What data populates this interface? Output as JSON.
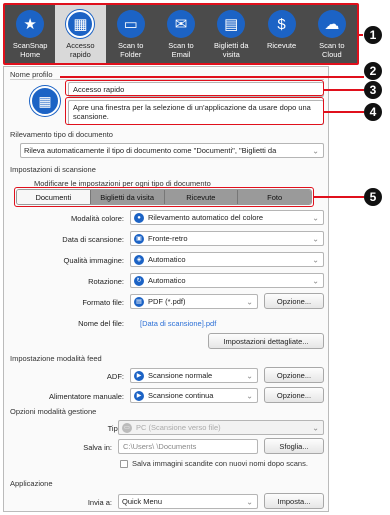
{
  "toolbar": {
    "items": [
      {
        "label": "ScanSnap\nHome",
        "icon": "star-icon",
        "glyph": "★"
      },
      {
        "label": "Accesso\nrapido",
        "icon": "grid-icon",
        "glyph": "▦"
      },
      {
        "label": "Scan to\nFolder",
        "icon": "folder-icon",
        "glyph": "▭"
      },
      {
        "label": "Scan to\nEmail",
        "icon": "mail-icon",
        "glyph": "✉"
      },
      {
        "label": "Biglietti da\nvisita",
        "icon": "card-icon",
        "glyph": "▤"
      },
      {
        "label": "Ricevute",
        "icon": "receipt-icon",
        "glyph": "$"
      },
      {
        "label": "Scan to\nCloud",
        "icon": "cloud-icon",
        "glyph": "☁"
      }
    ]
  },
  "callouts": [
    "1",
    "2",
    "3",
    "4",
    "5"
  ],
  "profile": {
    "section_label": "Nome profilo",
    "name_value": "Accesso rapido",
    "description": "Apre una finestra per la selezione di un'applicazione da usare dopo una scansione."
  },
  "doc_detection": {
    "section_label": "Rilevamento tipo di documento",
    "value": "Rileva automaticamente il tipo di documento come \"Documenti\", \"Biglietti da"
  },
  "scan_settings": {
    "section_label": "Impostazioni di scansione",
    "subtitle": "Modificare le impostazioni per ogni tipo di documento",
    "tabs": [
      "Documenti",
      "Biglietti da visita",
      "Ricevute",
      "Foto"
    ],
    "color_mode": {
      "label": "Modalità colore:",
      "value": "Rilevamento automatico del colore"
    },
    "scan_side": {
      "label": "Data di scansione:",
      "value": "Fronte-retro"
    },
    "image_quality": {
      "label": "Qualità immagine:",
      "value": "Automatico"
    },
    "rotation": {
      "label": "Rotazione:",
      "value": "Automatico"
    },
    "file_format": {
      "label": "Formato file:",
      "value": "PDF (*.pdf)",
      "option_button": "Opzione..."
    },
    "file_name": {
      "label": "Nome del file:",
      "value": "[Data di scansione].pdf"
    },
    "advanced_button": "Impostazioni dettagliate..."
  },
  "feed_mode": {
    "section_label": "Impostazione modalità feed",
    "adf": {
      "label": "ADF:",
      "value": "Scansione normale",
      "option_button": "Opzione..."
    },
    "manual": {
      "label": "Alimentatore manuale:",
      "value": "Scansione continua",
      "option_button": "Opzione..."
    }
  },
  "management": {
    "section_label": "Opzioni modalità gestione",
    "type": {
      "label": "Tipo:",
      "value": "PC (Scansione verso file)"
    },
    "save_in": {
      "label": "Salva in:",
      "value": "C:\\Users\\           \\Documents",
      "browse_button": "Sfoglia..."
    },
    "checkbox_label": "Salva immagini scandite con nuovi nomi dopo scans."
  },
  "application": {
    "section_label": "Applicazione",
    "send_to": {
      "label": "Invia a:",
      "value": "Quick Menu",
      "set_button": "Imposta..."
    }
  },
  "colors": {
    "accent": "#1c63c5",
    "callout_red": "#e0101c",
    "toolbar_bg": "#4b4b4b"
  }
}
